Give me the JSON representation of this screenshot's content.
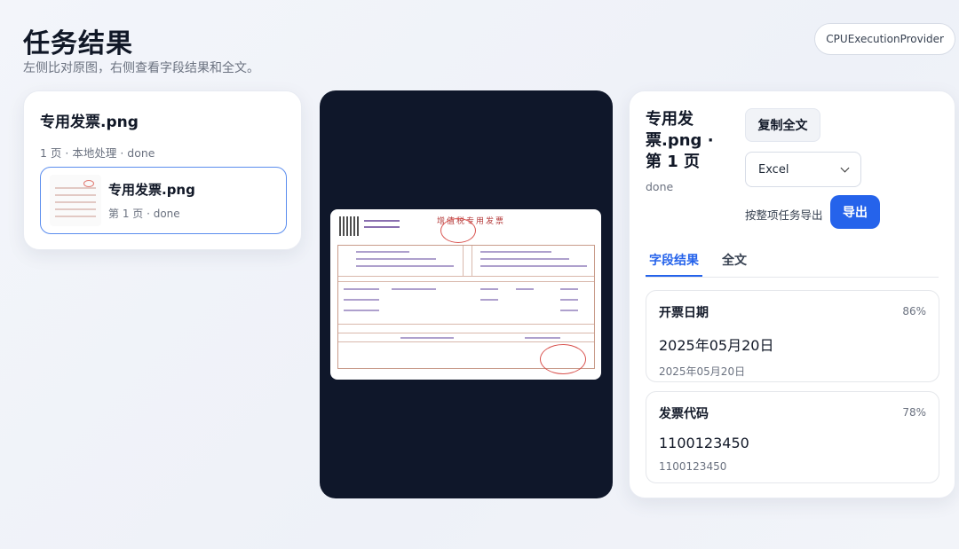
{
  "header": {
    "title": "任务结果",
    "subtitle": "左侧比对原图，右侧查看字段结果和全文。",
    "provider": "CPUExecutionProvider"
  },
  "left": {
    "title": "专用发票.png",
    "meta": "1 页 · 本地处理 · done",
    "file": {
      "name": "专用发票.png",
      "sub": "第 1 页 · done"
    }
  },
  "preview": {
    "invoice_title": "增值税专用发票"
  },
  "right": {
    "title": "专用发票.png · 第 1 页",
    "status": "done",
    "copy_label": "复制全文",
    "format_selected": "Excel",
    "export_hint": "按整项任务导出",
    "export_label": "导出",
    "tabs": [
      {
        "label": "字段结果",
        "active": true
      },
      {
        "label": "全文",
        "active": false
      }
    ],
    "fields": [
      {
        "label": "开票日期",
        "confidence": "86%",
        "value": "2025年05月20日",
        "raw": "2025年05月20日"
      },
      {
        "label": "发票代码",
        "confidence": "78%",
        "value": "1100123450",
        "raw": "1100123450"
      }
    ]
  },
  "colors": {
    "accent": "#2563eb",
    "preview_bg": "#0f172a",
    "stamp": "#d9534f"
  }
}
